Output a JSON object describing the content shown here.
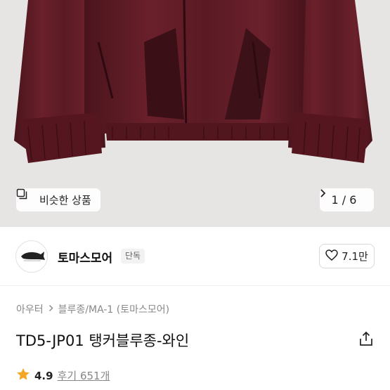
{
  "hero": {
    "similar_label": "비슷한 상품",
    "similar_icon": "similar-products-icon",
    "pager_text": "1 / 6",
    "pager_icon": "chevron-right-icon"
  },
  "brand": {
    "name": "토마스모어",
    "badge": "단독",
    "like_count": "7.1만",
    "like_icon": "heart-outline-icon"
  },
  "breadcrumb": [
    "아우터",
    "블루종/MA-1 (토마스모어)"
  ],
  "product": {
    "title": "TD5-JP01 탱커블루종-와인",
    "share_icon": "share-icon"
  },
  "rating": {
    "score": "4.9",
    "review_text": "후기 651개",
    "star_color": "#f5a623"
  },
  "colors": {
    "jacket": "#5e1b25",
    "accent_star": "#f5a623"
  }
}
